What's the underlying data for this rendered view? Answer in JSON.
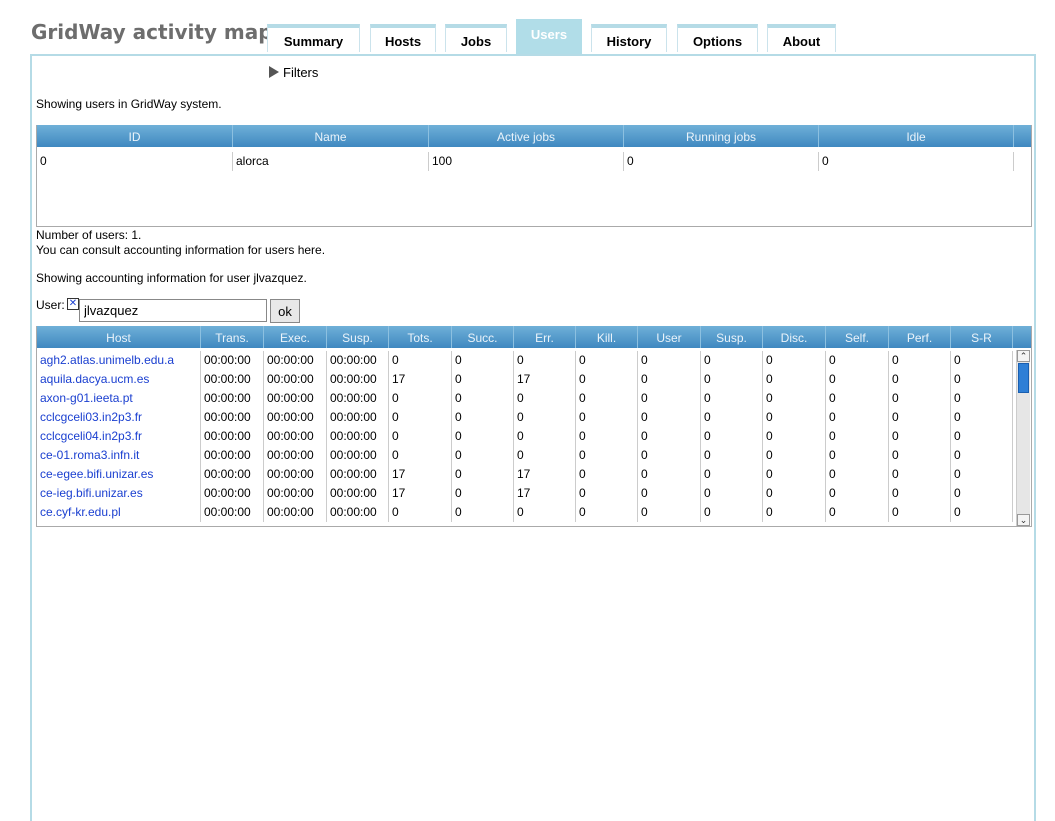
{
  "app": {
    "title": "GridWay activity map"
  },
  "tabs": [
    {
      "label": "Summary"
    },
    {
      "label": "Hosts"
    },
    {
      "label": "Jobs"
    },
    {
      "label": "Users"
    },
    {
      "label": "History"
    },
    {
      "label": "Options"
    },
    {
      "label": "About"
    }
  ],
  "active_tab": "Users",
  "filters": {
    "label": "Filters"
  },
  "users_section": {
    "intro": "Showing users in GridWay system.",
    "columns": [
      "ID",
      "Name",
      "Active jobs",
      "Running jobs",
      "Idle"
    ],
    "rows": [
      [
        "0",
        "alorca",
        "100",
        "0",
        "0"
      ]
    ],
    "count_text": "Number of users: 1.",
    "consult_text": "You can consult accounting information for users here."
  },
  "accounting": {
    "intro": "Showing accounting information for user jlvazquez.",
    "user_label": "User:",
    "user_value": "jlvazquez",
    "ok_label": "ok",
    "columns": [
      "Host",
      "Trans.",
      "Exec.",
      "Susp.",
      "Tots.",
      "Succ.",
      "Err.",
      "Kill.",
      "User",
      "Susp.",
      "Disc.",
      "Self.",
      "Perf.",
      "S-R"
    ],
    "rows": [
      [
        "agh2.atlas.unimelb.edu.a",
        "00:00:00",
        "00:00:00",
        "00:00:00",
        "0",
        "0",
        "0",
        "0",
        "0",
        "0",
        "0",
        "0",
        "0",
        "0"
      ],
      [
        "aquila.dacya.ucm.es",
        "00:00:00",
        "00:00:00",
        "00:00:00",
        "17",
        "0",
        "17",
        "0",
        "0",
        "0",
        "0",
        "0",
        "0",
        "0"
      ],
      [
        "axon-g01.ieeta.pt",
        "00:00:00",
        "00:00:00",
        "00:00:00",
        "0",
        "0",
        "0",
        "0",
        "0",
        "0",
        "0",
        "0",
        "0",
        "0"
      ],
      [
        "cclcgceli03.in2p3.fr",
        "00:00:00",
        "00:00:00",
        "00:00:00",
        "0",
        "0",
        "0",
        "0",
        "0",
        "0",
        "0",
        "0",
        "0",
        "0"
      ],
      [
        "cclcgceli04.in2p3.fr",
        "00:00:00",
        "00:00:00",
        "00:00:00",
        "0",
        "0",
        "0",
        "0",
        "0",
        "0",
        "0",
        "0",
        "0",
        "0"
      ],
      [
        "ce-01.roma3.infn.it",
        "00:00:00",
        "00:00:00",
        "00:00:00",
        "0",
        "0",
        "0",
        "0",
        "0",
        "0",
        "0",
        "0",
        "0",
        "0"
      ],
      [
        "ce-egee.bifi.unizar.es",
        "00:00:00",
        "00:00:00",
        "00:00:00",
        "17",
        "0",
        "17",
        "0",
        "0",
        "0",
        "0",
        "0",
        "0",
        "0"
      ],
      [
        "ce-ieg.bifi.unizar.es",
        "00:00:00",
        "00:00:00",
        "00:00:00",
        "17",
        "0",
        "17",
        "0",
        "0",
        "0",
        "0",
        "0",
        "0",
        "0"
      ],
      [
        "ce.cyf-kr.edu.pl",
        "00:00:00",
        "00:00:00",
        "00:00:00",
        "0",
        "0",
        "0",
        "0",
        "0",
        "0",
        "0",
        "0",
        "0",
        "0"
      ]
    ]
  },
  "icons": {
    "filters": "triangle-right-icon",
    "checkbox": "checkbox-x-icon",
    "scroll_up": "chevron-up-icon",
    "scroll_down": "chevron-down-icon"
  },
  "colors": {
    "header_top": "#6fb0d8",
    "header_bottom": "#3f88c0",
    "tab_active": "#b1dde8",
    "link": "#1a3fd0",
    "scroll_thumb": "#2e7fd6"
  }
}
